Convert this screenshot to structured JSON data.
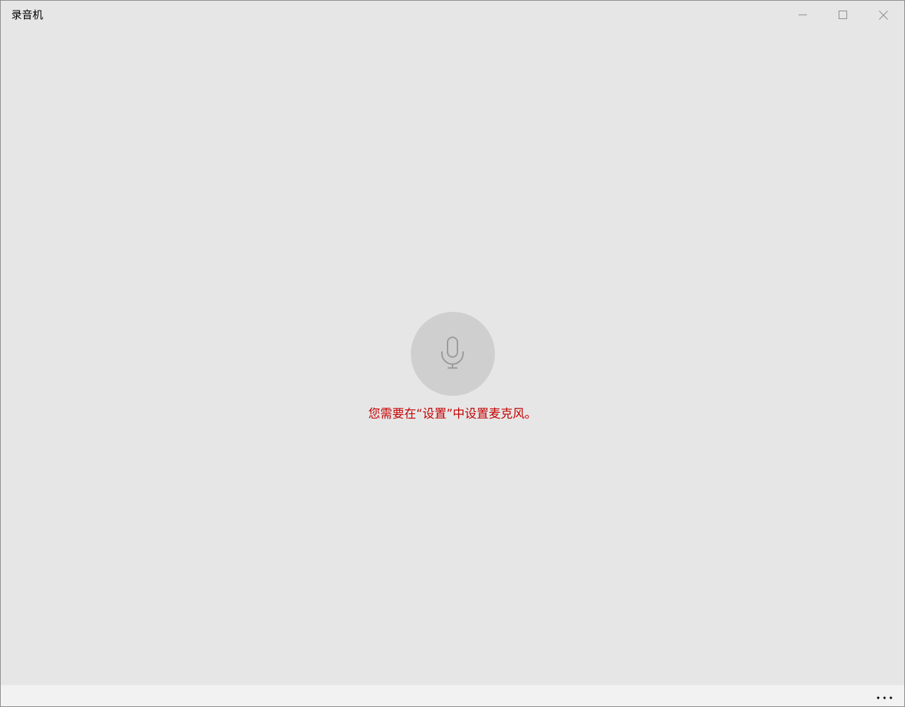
{
  "window": {
    "title": "录音机",
    "controls": {
      "minimize_icon": "minimize-icon",
      "maximize_icon": "maximize-icon",
      "close_icon": "close-icon"
    }
  },
  "main": {
    "mic_icon": "microphone-icon",
    "message": "您需要在“设置”中设置麦克风。",
    "message_color": "#c40000"
  },
  "bottom_bar": {
    "more_icon": "more-ellipsis-icon"
  }
}
